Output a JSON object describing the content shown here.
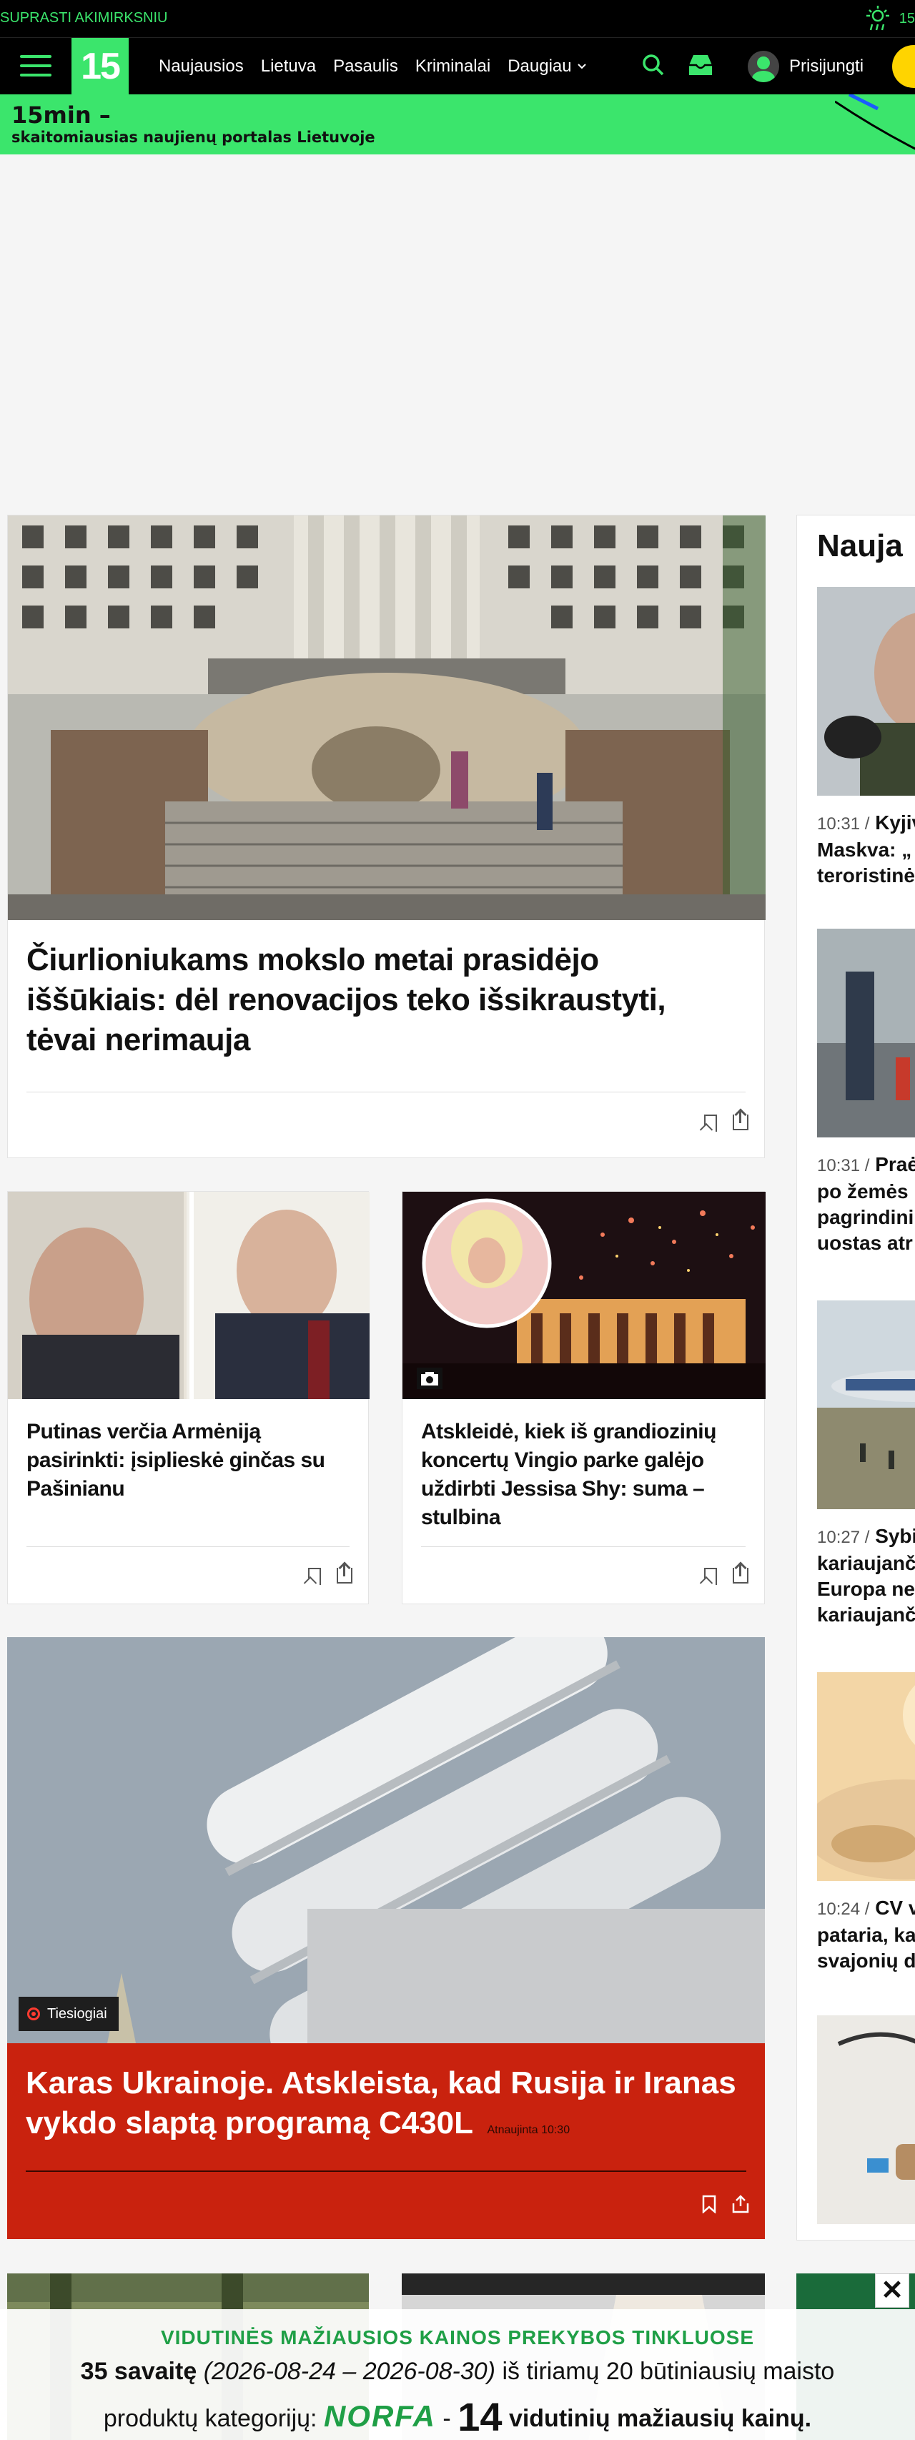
{
  "topbar": {
    "tag": "SUPRASTI AKIMIRKSNIU",
    "weather_temp": "15"
  },
  "nav": {
    "logo": "15",
    "links": [
      "Naujausios",
      "Lietuva",
      "Pasaulis",
      "Kriminalai",
      "Daugiau"
    ],
    "login": "Prisijungti"
  },
  "slogan": {
    "line1": "15min –",
    "line2": "skaitomiausias naujienų portalas Lietuvoje"
  },
  "articles": {
    "a1": {
      "title": "Čiurlioniukams mokslo metai prasidėjo iššūkiais: dėl renovacijos teko išsikraustyti, tėvai nerimauja"
    },
    "a2": {
      "title": "Putinas verčia Armėniją pasirinkti: įsiplieskė ginčas su Pašinianu"
    },
    "a3": {
      "title": "Atskleidė, kiek iš grandiozinių koncertų Vingio parke galėjo uždirbti Jessisa Shy: suma – stulbina"
    },
    "a4": {
      "title": "Karas Ukrainoje. Atskleista, kad Rusija ir Iranas vykdo slaptą programą C430L",
      "updated": "Atnaujinta 10:30",
      "live": "Tiesiogiai"
    }
  },
  "latest": {
    "heading": "Nauja",
    "items": [
      {
        "time": "10:31 /",
        "lines": [
          "Kyjiv",
          "Maskva: „",
          "teroristinė"
        ]
      },
      {
        "time": "10:31 /",
        "lines": [
          "Praė",
          "po žemės",
          "pagrindini",
          "uostas atr"
        ]
      },
      {
        "time": "10:27 /",
        "lines": [
          "Sybi",
          "kariaujanč",
          "Europa ne",
          "kariaujanč"
        ]
      },
      {
        "time": "10:24 /",
        "lines": [
          "CV v",
          "pataria, ka",
          "svajonių d"
        ]
      }
    ]
  },
  "promo": {
    "line1": "VIDUTINĖS MAŽIAUSIOS KAINOS PREKYBOS TINKLUOSE",
    "l2a": "35 savaitę",
    "l2b": "(2026-08-24 – 2026-08-30)",
    "l2c": "iš tiriamų 20 būtiniausių maisto",
    "l3a": "produktų kategorijų:",
    "brand": "NORFA",
    "dash": "-",
    "big": "14",
    "l3b": "vidutinių mažiausių kainų."
  },
  "colors": {
    "accent": "#3be56c",
    "live_red": "#c9220e",
    "yellow": "#ffd400"
  }
}
